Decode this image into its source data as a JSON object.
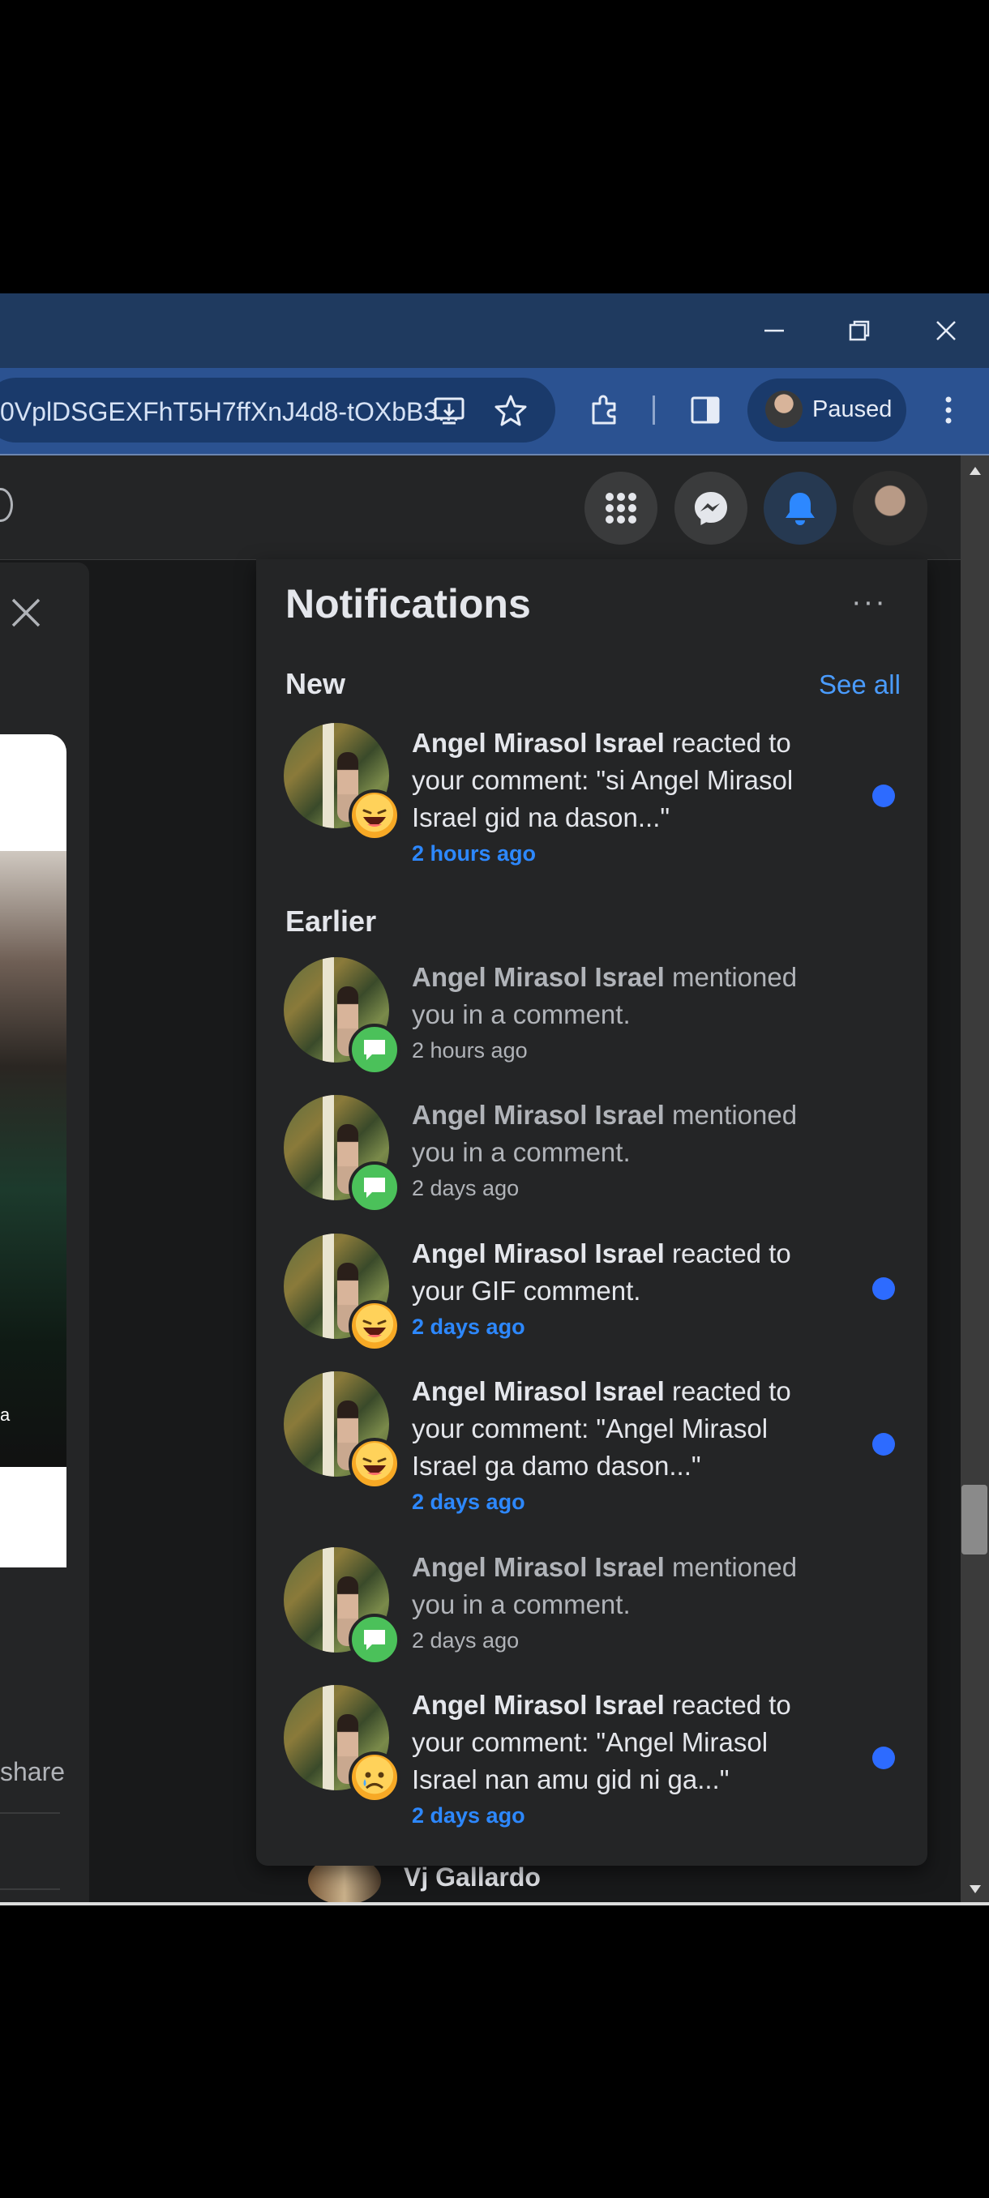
{
  "browser": {
    "url_text": "0VplDSGEXFhT5H7ffXnJ4d8-tOXbB3...",
    "profile_status": "Paused"
  },
  "notifications": {
    "title": "Notifications",
    "more_label": "···",
    "new_heading": "New",
    "see_all": "See all",
    "earlier_heading": "Earlier",
    "new_items": [
      {
        "name": "Angel Mirasol Israel",
        "action": " reacted to your comment: \"si Angel Mirasol Israel gid na dason...\"",
        "time": "2 hours ago",
        "badge": "haha-reaction",
        "unread": true
      }
    ],
    "earlier_items": [
      {
        "name": "Angel Mirasol Israel",
        "action": " mentioned you in a comment.",
        "time": "2 hours ago",
        "badge": "comment",
        "unread": false
      },
      {
        "name": "Angel Mirasol Israel",
        "action": " mentioned you in a comment.",
        "time": "2 days ago",
        "badge": "comment",
        "unread": false
      },
      {
        "name": "Angel Mirasol Israel",
        "action": " reacted to your GIF comment.",
        "time": "2 days ago",
        "badge": "haha-reaction",
        "unread": true
      },
      {
        "name": "Angel Mirasol Israel",
        "action": " reacted to your comment: \"Angel Mirasol Israel ga damo dason...\"",
        "time": "2 days ago",
        "badge": "haha-reaction",
        "unread": true
      },
      {
        "name": "Angel Mirasol Israel",
        "action": " mentioned you in a comment.",
        "time": "2 days ago",
        "badge": "comment",
        "unread": false
      },
      {
        "name": "Angel Mirasol Israel",
        "action": " reacted to your comment: \"Angel Mirasol Israel nan amu gid ni ga...\"",
        "time": "2 days ago",
        "badge": "sad-reaction",
        "unread": true
      }
    ]
  },
  "background": {
    "share_label": "share",
    "contact_name": "Vj Gallardo",
    "post_caption_fragment": "a"
  },
  "colors": {
    "accent_blue": "#2d88ff",
    "unread_dot": "#2d6bff",
    "panel_bg": "#242526",
    "chrome_toolbar": "#2b5291"
  }
}
